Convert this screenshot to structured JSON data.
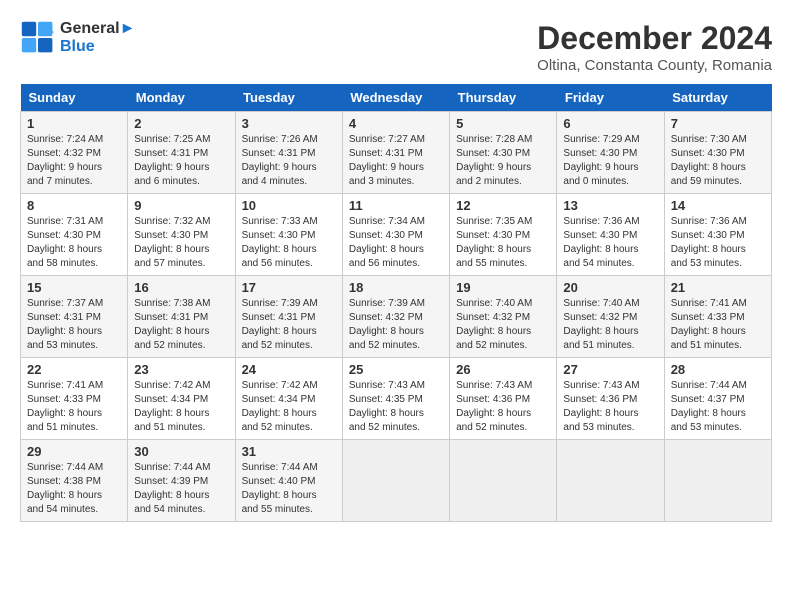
{
  "header": {
    "logo_line1": "General",
    "logo_line2": "Blue",
    "month": "December 2024",
    "location": "Oltina, Constanta County, Romania"
  },
  "weekdays": [
    "Sunday",
    "Monday",
    "Tuesday",
    "Wednesday",
    "Thursday",
    "Friday",
    "Saturday"
  ],
  "weeks": [
    [
      {
        "day": "1",
        "info": "Sunrise: 7:24 AM\nSunset: 4:32 PM\nDaylight: 9 hours and 7 minutes."
      },
      {
        "day": "2",
        "info": "Sunrise: 7:25 AM\nSunset: 4:31 PM\nDaylight: 9 hours and 6 minutes."
      },
      {
        "day": "3",
        "info": "Sunrise: 7:26 AM\nSunset: 4:31 PM\nDaylight: 9 hours and 4 minutes."
      },
      {
        "day": "4",
        "info": "Sunrise: 7:27 AM\nSunset: 4:31 PM\nDaylight: 9 hours and 3 minutes."
      },
      {
        "day": "5",
        "info": "Sunrise: 7:28 AM\nSunset: 4:30 PM\nDaylight: 9 hours and 2 minutes."
      },
      {
        "day": "6",
        "info": "Sunrise: 7:29 AM\nSunset: 4:30 PM\nDaylight: 9 hours and 0 minutes."
      },
      {
        "day": "7",
        "info": "Sunrise: 7:30 AM\nSunset: 4:30 PM\nDaylight: 8 hours and 59 minutes."
      }
    ],
    [
      {
        "day": "8",
        "info": "Sunrise: 7:31 AM\nSunset: 4:30 PM\nDaylight: 8 hours and 58 minutes."
      },
      {
        "day": "9",
        "info": "Sunrise: 7:32 AM\nSunset: 4:30 PM\nDaylight: 8 hours and 57 minutes."
      },
      {
        "day": "10",
        "info": "Sunrise: 7:33 AM\nSunset: 4:30 PM\nDaylight: 8 hours and 56 minutes."
      },
      {
        "day": "11",
        "info": "Sunrise: 7:34 AM\nSunset: 4:30 PM\nDaylight: 8 hours and 56 minutes."
      },
      {
        "day": "12",
        "info": "Sunrise: 7:35 AM\nSunset: 4:30 PM\nDaylight: 8 hours and 55 minutes."
      },
      {
        "day": "13",
        "info": "Sunrise: 7:36 AM\nSunset: 4:30 PM\nDaylight: 8 hours and 54 minutes."
      },
      {
        "day": "14",
        "info": "Sunrise: 7:36 AM\nSunset: 4:30 PM\nDaylight: 8 hours and 53 minutes."
      }
    ],
    [
      {
        "day": "15",
        "info": "Sunrise: 7:37 AM\nSunset: 4:31 PM\nDaylight: 8 hours and 53 minutes."
      },
      {
        "day": "16",
        "info": "Sunrise: 7:38 AM\nSunset: 4:31 PM\nDaylight: 8 hours and 52 minutes."
      },
      {
        "day": "17",
        "info": "Sunrise: 7:39 AM\nSunset: 4:31 PM\nDaylight: 8 hours and 52 minutes."
      },
      {
        "day": "18",
        "info": "Sunrise: 7:39 AM\nSunset: 4:32 PM\nDaylight: 8 hours and 52 minutes."
      },
      {
        "day": "19",
        "info": "Sunrise: 7:40 AM\nSunset: 4:32 PM\nDaylight: 8 hours and 52 minutes."
      },
      {
        "day": "20",
        "info": "Sunrise: 7:40 AM\nSunset: 4:32 PM\nDaylight: 8 hours and 51 minutes."
      },
      {
        "day": "21",
        "info": "Sunrise: 7:41 AM\nSunset: 4:33 PM\nDaylight: 8 hours and 51 minutes."
      }
    ],
    [
      {
        "day": "22",
        "info": "Sunrise: 7:41 AM\nSunset: 4:33 PM\nDaylight: 8 hours and 51 minutes."
      },
      {
        "day": "23",
        "info": "Sunrise: 7:42 AM\nSunset: 4:34 PM\nDaylight: 8 hours and 51 minutes."
      },
      {
        "day": "24",
        "info": "Sunrise: 7:42 AM\nSunset: 4:34 PM\nDaylight: 8 hours and 52 minutes."
      },
      {
        "day": "25",
        "info": "Sunrise: 7:43 AM\nSunset: 4:35 PM\nDaylight: 8 hours and 52 minutes."
      },
      {
        "day": "26",
        "info": "Sunrise: 7:43 AM\nSunset: 4:36 PM\nDaylight: 8 hours and 52 minutes."
      },
      {
        "day": "27",
        "info": "Sunrise: 7:43 AM\nSunset: 4:36 PM\nDaylight: 8 hours and 53 minutes."
      },
      {
        "day": "28",
        "info": "Sunrise: 7:44 AM\nSunset: 4:37 PM\nDaylight: 8 hours and 53 minutes."
      }
    ],
    [
      {
        "day": "29",
        "info": "Sunrise: 7:44 AM\nSunset: 4:38 PM\nDaylight: 8 hours and 54 minutes."
      },
      {
        "day": "30",
        "info": "Sunrise: 7:44 AM\nSunset: 4:39 PM\nDaylight: 8 hours and 54 minutes."
      },
      {
        "day": "31",
        "info": "Sunrise: 7:44 AM\nSunset: 4:40 PM\nDaylight: 8 hours and 55 minutes."
      },
      null,
      null,
      null,
      null
    ]
  ]
}
